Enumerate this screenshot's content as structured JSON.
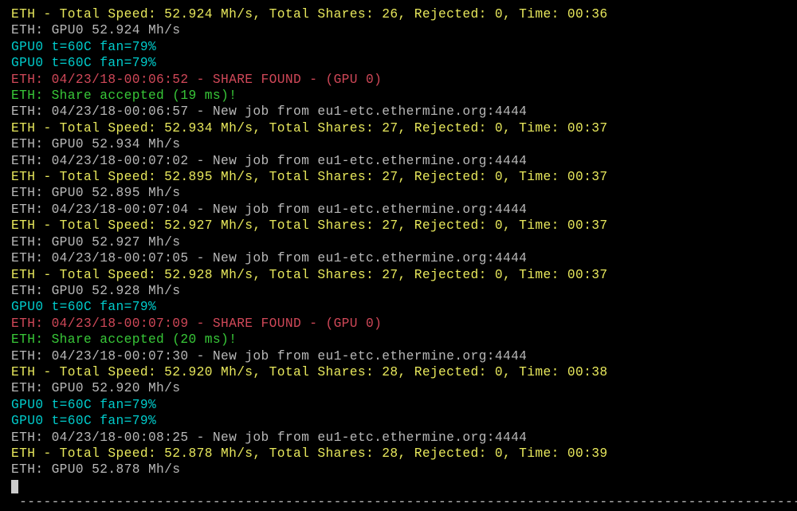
{
  "lines": [
    {
      "class": "yellow",
      "text": "ETH - Total Speed: 52.924 Mh/s, Total Shares: 26, Rejected: 0, Time: 00:36"
    },
    {
      "class": "gray",
      "text": "ETH: GPU0 52.924 Mh/s"
    },
    {
      "class": "cyan",
      "text": "GPU0 t=60C fan=79%"
    },
    {
      "class": "cyan",
      "text": "GPU0 t=60C fan=79%"
    },
    {
      "class": "red",
      "text": "ETH: 04/23/18-00:06:52 - SHARE FOUND - (GPU 0)"
    },
    {
      "class": "green",
      "text": "ETH: Share accepted (19 ms)!"
    },
    {
      "class": "gray",
      "text": "ETH: 04/23/18-00:06:57 - New job from eu1-etc.ethermine.org:4444"
    },
    {
      "class": "yellow",
      "text": "ETH - Total Speed: 52.934 Mh/s, Total Shares: 27, Rejected: 0, Time: 00:37"
    },
    {
      "class": "gray",
      "text": "ETH: GPU0 52.934 Mh/s"
    },
    {
      "class": "gray",
      "text": "ETH: 04/23/18-00:07:02 - New job from eu1-etc.ethermine.org:4444"
    },
    {
      "class": "yellow",
      "text": "ETH - Total Speed: 52.895 Mh/s, Total Shares: 27, Rejected: 0, Time: 00:37"
    },
    {
      "class": "gray",
      "text": "ETH: GPU0 52.895 Mh/s"
    },
    {
      "class": "gray",
      "text": "ETH: 04/23/18-00:07:04 - New job from eu1-etc.ethermine.org:4444"
    },
    {
      "class": "yellow",
      "text": "ETH - Total Speed: 52.927 Mh/s, Total Shares: 27, Rejected: 0, Time: 00:37"
    },
    {
      "class": "gray",
      "text": "ETH: GPU0 52.927 Mh/s"
    },
    {
      "class": "gray",
      "text": "ETH: 04/23/18-00:07:05 - New job from eu1-etc.ethermine.org:4444"
    },
    {
      "class": "yellow",
      "text": "ETH - Total Speed: 52.928 Mh/s, Total Shares: 27, Rejected: 0, Time: 00:37"
    },
    {
      "class": "gray",
      "text": "ETH: GPU0 52.928 Mh/s"
    },
    {
      "class": "cyan",
      "text": "GPU0 t=60C fan=79%"
    },
    {
      "class": "red",
      "text": "ETH: 04/23/18-00:07:09 - SHARE FOUND - (GPU 0)"
    },
    {
      "class": "green",
      "text": "ETH: Share accepted (20 ms)!"
    },
    {
      "class": "gray",
      "text": "ETH: 04/23/18-00:07:30 - New job from eu1-etc.ethermine.org:4444"
    },
    {
      "class": "yellow",
      "text": "ETH - Total Speed: 52.920 Mh/s, Total Shares: 28, Rejected: 0, Time: 00:38"
    },
    {
      "class": "gray",
      "text": "ETH: GPU0 52.920 Mh/s"
    },
    {
      "class": "cyan",
      "text": "GPU0 t=60C fan=79%"
    },
    {
      "class": "cyan",
      "text": "GPU0 t=60C fan=79%"
    },
    {
      "class": "gray",
      "text": "ETH: 04/23/18-00:08:25 - New job from eu1-etc.ethermine.org:4444"
    },
    {
      "class": "yellow",
      "text": "ETH - Total Speed: 52.878 Mh/s, Total Shares: 28, Rejected: 0, Time: 00:39"
    },
    {
      "class": "gray",
      "text": "ETH: GPU0 52.878 Mh/s"
    }
  ],
  "divider": " -------------------------------------------------------------------------------------------------------"
}
